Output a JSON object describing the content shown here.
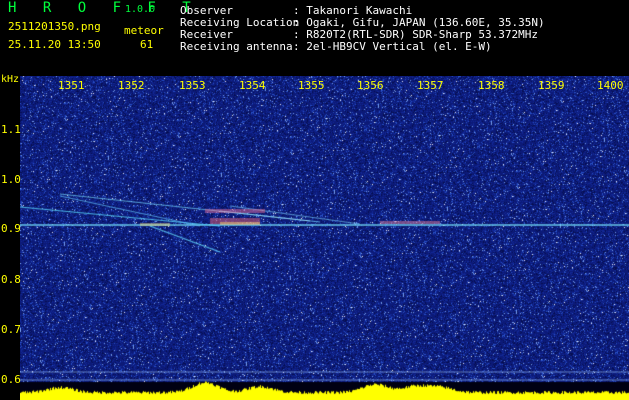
{
  "app": {
    "name": "H R O F F T",
    "version": "1.0.0"
  },
  "capture": {
    "filename": "2511201350.png",
    "datetime": "25.11.20 13:50",
    "meteor_label": "meteor",
    "meteor_count": "61"
  },
  "info": [
    {
      "label": "Observer",
      "value": ": Takanori Kawachi"
    },
    {
      "label": "Receiving Location",
      "value": ": Ogaki, Gifu, JAPAN (136.60E, 35.35N)"
    },
    {
      "label": "Receiver",
      "value": ": R820T2(RTL-SDR) SDR-Sharp 53.372MHz"
    },
    {
      "label": "Receiving antenna",
      "value": ": 2el-HB9CV Vertical (el. E-W)"
    }
  ],
  "axes": {
    "y_unit": "kHz",
    "x_ticks": [
      "1351",
      "1352",
      "1353",
      "1354",
      "1355",
      "1356",
      "1357",
      "1358",
      "1359",
      "1400"
    ],
    "y_ticks": [
      "1.1",
      "1.0",
      "0.9",
      "0.8",
      "0.7",
      "0.6"
    ]
  },
  "colors": {
    "background": "#000000",
    "header_green": "#00ff3c",
    "axis_yellow": "#ffff00",
    "spectrum_blue": "#102080"
  }
}
